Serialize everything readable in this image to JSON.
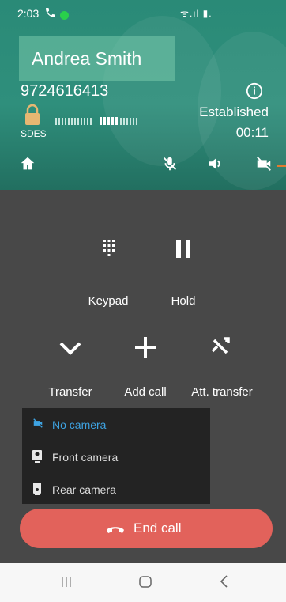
{
  "status_bar": {
    "time": "2:03",
    "signal_text": "ᯤ.ıl ▮."
  },
  "caller": {
    "name": "Andrea Smith",
    "number": "9724616413"
  },
  "security": {
    "label": "SDES"
  },
  "call_state": {
    "status": "Established",
    "duration": "00:11"
  },
  "controls": [
    {
      "label": "Keypad"
    },
    {
      "label": "Hold"
    },
    {
      "label": "Transfer"
    },
    {
      "label": "Add call"
    },
    {
      "label": "Att. transfer"
    }
  ],
  "camera_menu": {
    "items": [
      {
        "label": "No camera",
        "selected": true
      },
      {
        "label": "Front camera",
        "selected": false
      },
      {
        "label": "Rear camera",
        "selected": false
      }
    ]
  },
  "end_call": {
    "label": "End call"
  },
  "colors": {
    "header": "#2f8f7c",
    "end_call": "#e2625b",
    "selected": "#3ea3e2",
    "panel": "#484848"
  }
}
